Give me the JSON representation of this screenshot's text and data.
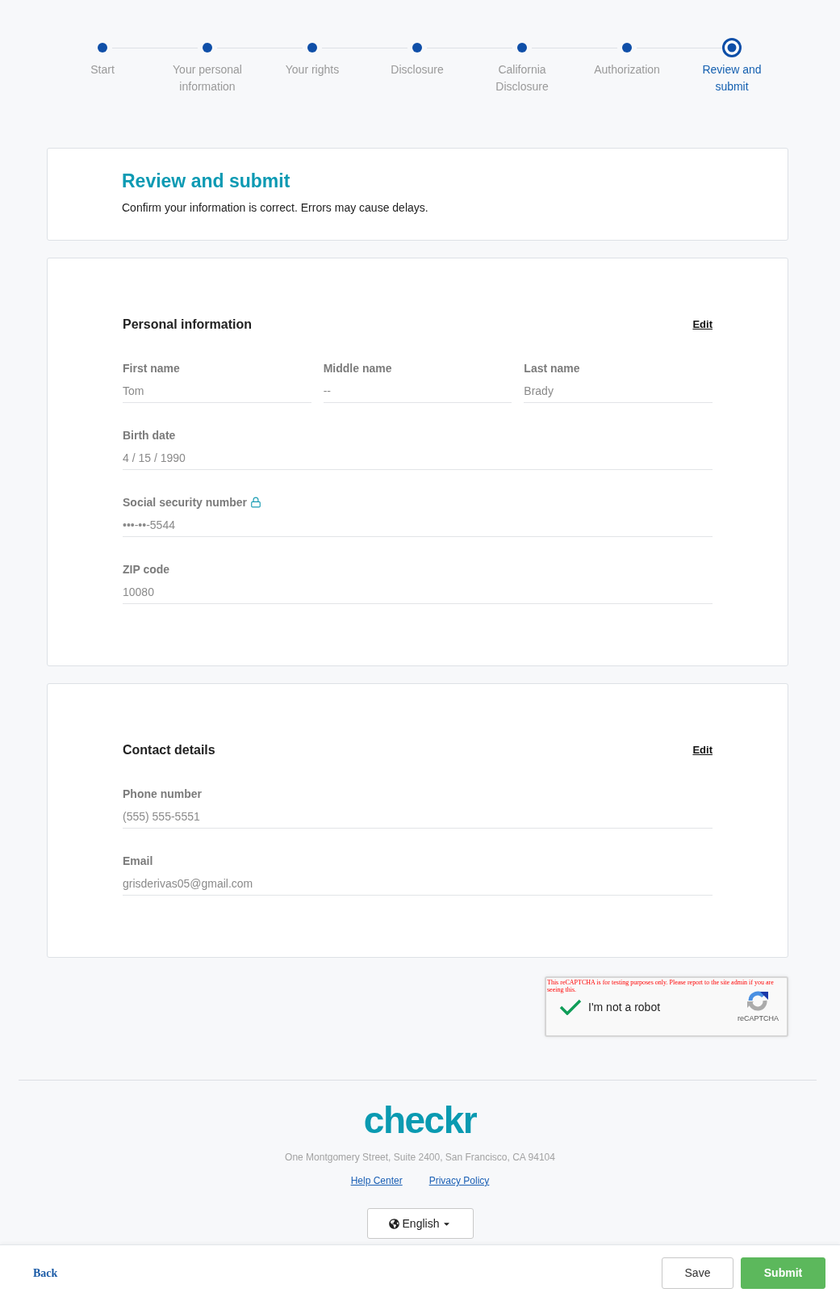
{
  "stepper": {
    "steps": [
      {
        "label": "Start",
        "selected": false
      },
      {
        "label": "Your personal information",
        "selected": false
      },
      {
        "label": "Your rights",
        "selected": false
      },
      {
        "label": "Disclosure",
        "selected": false
      },
      {
        "label": "California Disclosure",
        "selected": false
      },
      {
        "label": "Authorization",
        "selected": false
      },
      {
        "label": "Review and submit",
        "selected": true
      }
    ]
  },
  "header": {
    "title": "Review and submit",
    "subtitle": "Confirm your information is correct. Errors may cause delays."
  },
  "sections": [
    {
      "title": "Personal information",
      "edit": "Edit",
      "rows": [
        [
          {
            "label": "First name",
            "value": "Tom",
            "locked": false
          },
          {
            "label": "Middle name",
            "value": "--",
            "locked": false
          },
          {
            "label": "Last name",
            "value": "Brady",
            "locked": false
          }
        ],
        [
          {
            "label": "Birth date",
            "value": "4 / 15 / 1990",
            "locked": false
          }
        ],
        [
          {
            "label": "Social security number",
            "value": "•••-••-5544",
            "locked": true
          }
        ],
        [
          {
            "label": "ZIP code",
            "value": "10080",
            "locked": false
          }
        ]
      ]
    },
    {
      "title": "Contact details",
      "edit": "Edit",
      "rows": [
        [
          {
            "label": "Phone number",
            "value": "(555) 555-5551",
            "locked": false
          }
        ],
        [
          {
            "label": "Email",
            "value": "grisderivas05@gmail.com",
            "locked": false
          }
        ]
      ]
    }
  ],
  "recaptcha": {
    "notice": "This reCAPTCHA is for testing purposes only. Please report to the site admin if you are seeing this.",
    "label": "I'm not a robot",
    "checked": true,
    "brand": "reCAPTCHA"
  },
  "footer": {
    "logo": "checkr",
    "address": "One Montgomery Street, Suite 2400, San Francisco, CA 94104",
    "links": [
      "Help Center",
      "Privacy Policy"
    ],
    "language": "English"
  },
  "action_bar": {
    "back": "Back",
    "buttons": [
      {
        "label": "Save",
        "kind": "secondary"
      },
      {
        "label": "Submit",
        "kind": "primary"
      }
    ]
  }
}
